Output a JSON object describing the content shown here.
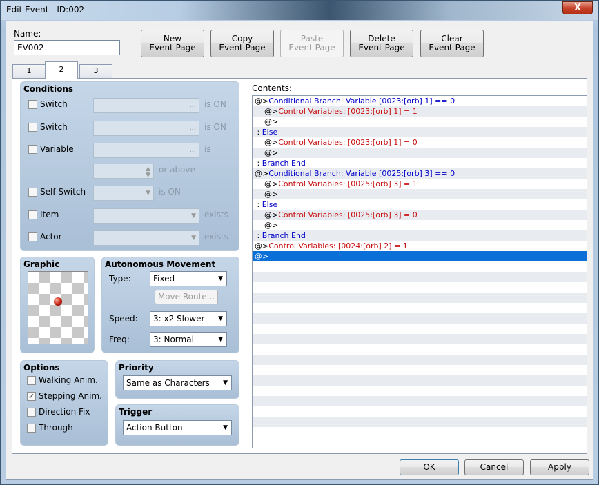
{
  "window": {
    "title": "Edit Event - ID:002",
    "close_glyph": "X"
  },
  "name_label": "Name:",
  "name_value": "EV002",
  "toolbar": [
    {
      "line1": "New",
      "line2": "Event Page",
      "enabled": true
    },
    {
      "line1": "Copy",
      "line2": "Event Page",
      "enabled": true
    },
    {
      "line1": "Paste",
      "line2": "Event Page",
      "enabled": false
    },
    {
      "line1": "Delete",
      "line2": "Event Page",
      "enabled": true
    },
    {
      "line1": "Clear",
      "line2": "Event Page",
      "enabled": true
    }
  ],
  "tabs": [
    "1",
    "2",
    "3"
  ],
  "active_tab": "2",
  "conditions": {
    "title": "Conditions",
    "switch1": {
      "label": "Switch",
      "suffix": "is ON",
      "dots": "...",
      "checked": false
    },
    "switch2": {
      "label": "Switch",
      "suffix": "is ON",
      "dots": "...",
      "checked": false
    },
    "variable": {
      "label": "Variable",
      "suffix": "is",
      "dots": "...",
      "checked": false
    },
    "or_above": "or above",
    "self_switch": {
      "label": "Self Switch",
      "suffix": "is ON",
      "checked": false
    },
    "item": {
      "label": "Item",
      "suffix": "exists",
      "checked": false
    },
    "actor": {
      "label": "Actor",
      "suffix": "exists",
      "checked": false
    }
  },
  "graphic": {
    "title": "Graphic"
  },
  "autonomous": {
    "title": "Autonomous Movement",
    "type_label": "Type:",
    "type_value": "Fixed",
    "move_route": "Move Route...",
    "speed_label": "Speed:",
    "speed_value": "3: x2 Slower",
    "freq_label": "Freq:",
    "freq_value": "3: Normal"
  },
  "options": {
    "title": "Options",
    "items": [
      {
        "label": "Walking Anim.",
        "checked": false
      },
      {
        "label": "Stepping Anim.",
        "checked": true
      },
      {
        "label": "Direction Fix",
        "checked": false
      },
      {
        "label": "Through",
        "checked": false
      }
    ],
    "check_glyph": "✓"
  },
  "priority": {
    "title": "Priority",
    "value": "Same as Characters"
  },
  "trigger": {
    "title": "Trigger",
    "value": "Action Button"
  },
  "contents": {
    "label": "Contents:",
    "lines": [
      {
        "indent": 0,
        "prefix": "@>",
        "text": "Conditional Branch: Variable [0023:[orb] 1] == 0",
        "color": "blue"
      },
      {
        "indent": 1,
        "prefix": "@>",
        "text": "Control Variables: [0023:[orb] 1] = 1",
        "color": "red"
      },
      {
        "indent": 1,
        "prefix": "@>",
        "text": "",
        "color": "black"
      },
      {
        "indent": 0,
        "prefix": " : ",
        "text": "Else",
        "color": "blue"
      },
      {
        "indent": 1,
        "prefix": "@>",
        "text": "Control Variables: [0023:[orb] 1] = 0",
        "color": "red"
      },
      {
        "indent": 1,
        "prefix": "@>",
        "text": "",
        "color": "black"
      },
      {
        "indent": 0,
        "prefix": " : ",
        "text": "Branch End",
        "color": "blue"
      },
      {
        "indent": 0,
        "prefix": "@>",
        "text": "Conditional Branch: Variable [0025:[orb] 3] == 0",
        "color": "blue"
      },
      {
        "indent": 1,
        "prefix": "@>",
        "text": "Control Variables: [0025:[orb] 3] = 1",
        "color": "red"
      },
      {
        "indent": 1,
        "prefix": "@>",
        "text": "",
        "color": "black"
      },
      {
        "indent": 0,
        "prefix": " : ",
        "text": "Else",
        "color": "blue"
      },
      {
        "indent": 1,
        "prefix": "@>",
        "text": "Control Variables: [0025:[orb] 3] = 0",
        "color": "red"
      },
      {
        "indent": 1,
        "prefix": "@>",
        "text": "",
        "color": "black"
      },
      {
        "indent": 0,
        "prefix": " : ",
        "text": "Branch End",
        "color": "blue"
      },
      {
        "indent": 0,
        "prefix": "@>",
        "text": "Control Variables: [0024:[orb] 2] = 1",
        "color": "red"
      },
      {
        "indent": 0,
        "prefix": "@>",
        "text": "",
        "color": "black",
        "selected": true
      }
    ]
  },
  "bottom": {
    "ok": "OK",
    "cancel": "Cancel",
    "apply": "Apply"
  },
  "icons": {
    "dropdown": "▼",
    "spin_up": "▲",
    "spin_down": "▼"
  },
  "colors": {
    "command_blue": "#0000c8",
    "command_red": "#c81010",
    "selection": "#0a6fd6"
  }
}
